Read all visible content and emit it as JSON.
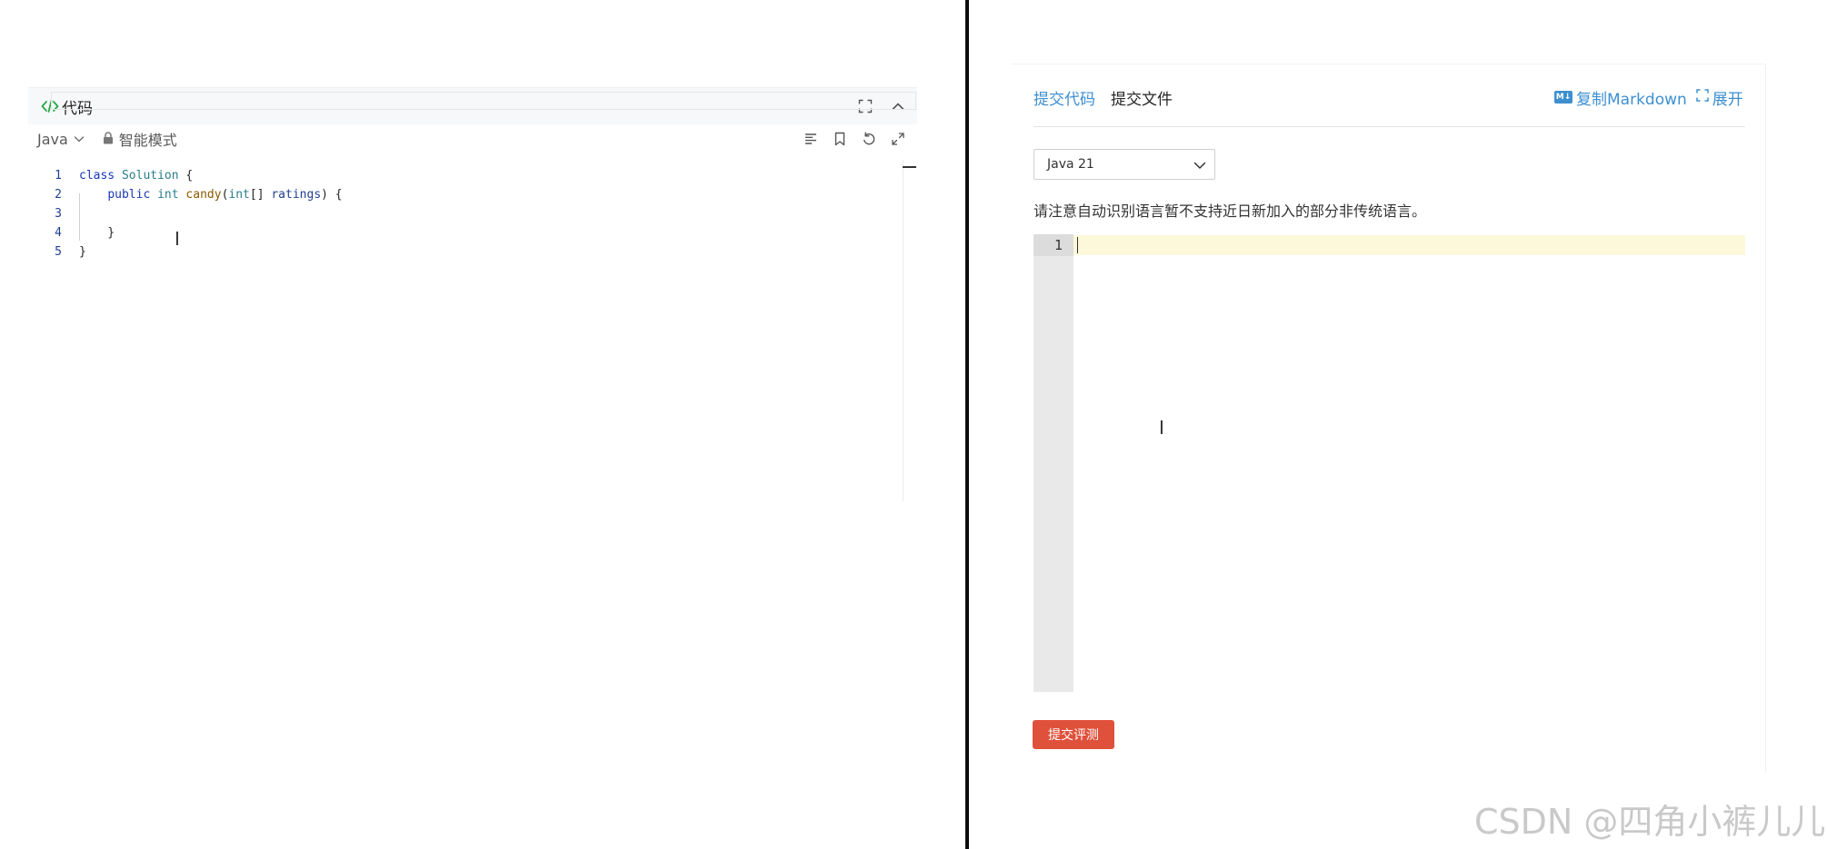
{
  "left": {
    "header": {
      "title": "代码",
      "code_icon": "code-brackets-icon",
      "fullscreen_icon": "fullscreen-icon",
      "collapse_icon": "chevron-up-icon"
    },
    "toolbar": {
      "language": "Java",
      "mode": "智能模式",
      "icons": [
        "format-icon",
        "bookmark-icon",
        "undo-icon",
        "expand-icon"
      ]
    },
    "editor": {
      "lines": [
        {
          "n": "1",
          "text": "class Solution {"
        },
        {
          "n": "2",
          "text": "    public int candy(int[] ratings) {"
        },
        {
          "n": "3",
          "text": ""
        },
        {
          "n": "4",
          "text": "    }"
        },
        {
          "n": "5",
          "text": "}"
        }
      ]
    }
  },
  "right": {
    "tabs": [
      "提交代码",
      "提交文件"
    ],
    "copy_markdown": "复制Markdown",
    "expand": "展开",
    "language_select": "Java 21",
    "notice": "请注意自动识别语言暂不支持近日新加入的部分非传统语言。",
    "line_number": "1",
    "submit_button": "提交评测"
  },
  "watermark": "CSDN @四角小裤儿儿",
  "colors": {
    "accent": "#3d8fd0",
    "submit": "#e0513b",
    "current_line": "#fdf8d9",
    "divider": "#0d0d0d"
  }
}
